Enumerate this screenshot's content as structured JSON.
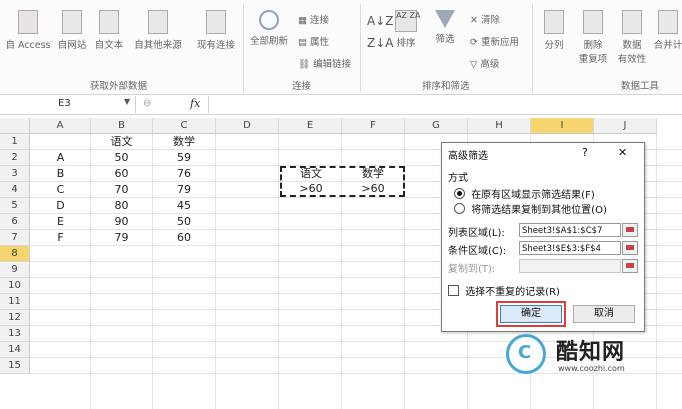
{
  "ribbon": {
    "items": {
      "access": "自 Access",
      "web": "自网站",
      "text": "自文本",
      "other": "自其他来源",
      "existing": "现有连接",
      "refresh": "全部刷新",
      "connections": "连接",
      "properties": "属性",
      "edit_links": "编辑链接",
      "sort": "排序",
      "filter": "筛选",
      "clear": "清除",
      "reapply": "重新应用",
      "advanced": "高级",
      "split": "分列",
      "remove_dup_1": "删除",
      "remove_dup_2": "重复项",
      "validation_1": "数据",
      "validation_2": "有效性",
      "consolidate": "合并计"
    },
    "groups": {
      "external": "获取外部数据",
      "connections": "连接",
      "sort_filter": "排序和筛选",
      "tools": "数据工具"
    }
  },
  "formula_bar": {
    "name_box": "E3",
    "fx": "fx",
    "content": ""
  },
  "sheet": {
    "columns": [
      "A",
      "B",
      "C",
      "D",
      "E",
      "F",
      "G",
      "H",
      "I",
      "J"
    ],
    "rows": [
      "1",
      "2",
      "3",
      "4",
      "5",
      "6",
      "7",
      "8",
      "9",
      "10",
      "11",
      "12",
      "13",
      "14",
      "15"
    ],
    "data": {
      "b1": "语文",
      "c1": "数学",
      "a2": "A",
      "b2": "50",
      "c2": "59",
      "a3": "B",
      "b3": "60",
      "c3": "76",
      "a4": "C",
      "b4": "70",
      "c4": "79",
      "a5": "D",
      "b5": "80",
      "c5": "45",
      "a6": "E",
      "b6": "90",
      "c6": "50",
      "a7": "F",
      "b7": "79",
      "c7": "60"
    },
    "criteria": {
      "e3": "语文",
      "f3": "数学",
      "e4": ">60",
      "f4": ">60"
    }
  },
  "dialog": {
    "title": "高级筛选",
    "help": "?",
    "close": "✕",
    "section_label": "方式",
    "option1": "在原有区域显示筛选结果(F)",
    "option2": "将筛选结果复制到其他位置(O)",
    "list_label": "列表区域(L):",
    "list_value": "Sheet3!$A$1:$C$7",
    "criteria_label": "条件区域(C):",
    "criteria_value": "Sheet3!$E$3:$F$4",
    "copy_label": "复制到(T):",
    "copy_value": "",
    "unique_label": "选择不重复的记录(R)",
    "ok": "确定",
    "cancel": "取消"
  },
  "watermark": {
    "name": "酷知网",
    "url": "www.coozhi.com"
  },
  "colors": {
    "highlight_border": "#e03a3a",
    "active_column": "#f5d66e",
    "ok_button": "#dbe9f8"
  }
}
